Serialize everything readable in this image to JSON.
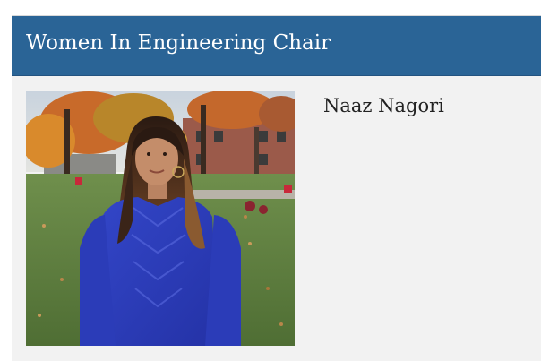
{
  "card": {
    "title": "Women In Engineering Chair",
    "member": {
      "name": "Naaz Nagori",
      "photo_icon": "portrait-photo-icon"
    }
  },
  "colors": {
    "header_background": "#2a6496",
    "card_background": "#f2f2f2",
    "title_text": "#ffffff",
    "name_text": "#222222"
  }
}
